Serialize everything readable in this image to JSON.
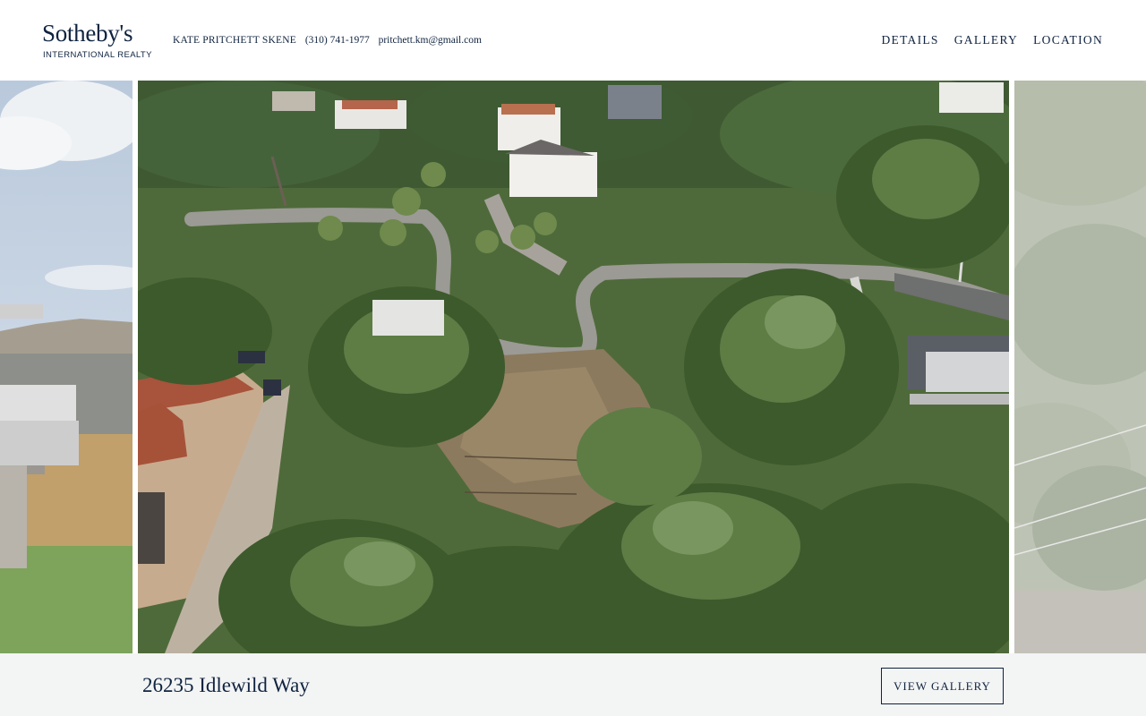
{
  "brand": {
    "name": "Sotheby's",
    "tagline": "INTERNATIONAL REALTY"
  },
  "agent": {
    "name": "KATE PRITCHETT SKENE",
    "phone": "(310) 741-1977",
    "email": "pritchett.km@gmail.com"
  },
  "nav": {
    "items": [
      {
        "label": "DETAILS"
      },
      {
        "label": "GALLERY"
      },
      {
        "label": "LOCATION"
      }
    ]
  },
  "listing": {
    "address": "26235 Idlewild Way",
    "view_gallery_label": "VIEW GALLERY"
  },
  "colors": {
    "brand_navy": "#0f2340",
    "footer_bg": "#f3f4f4"
  }
}
